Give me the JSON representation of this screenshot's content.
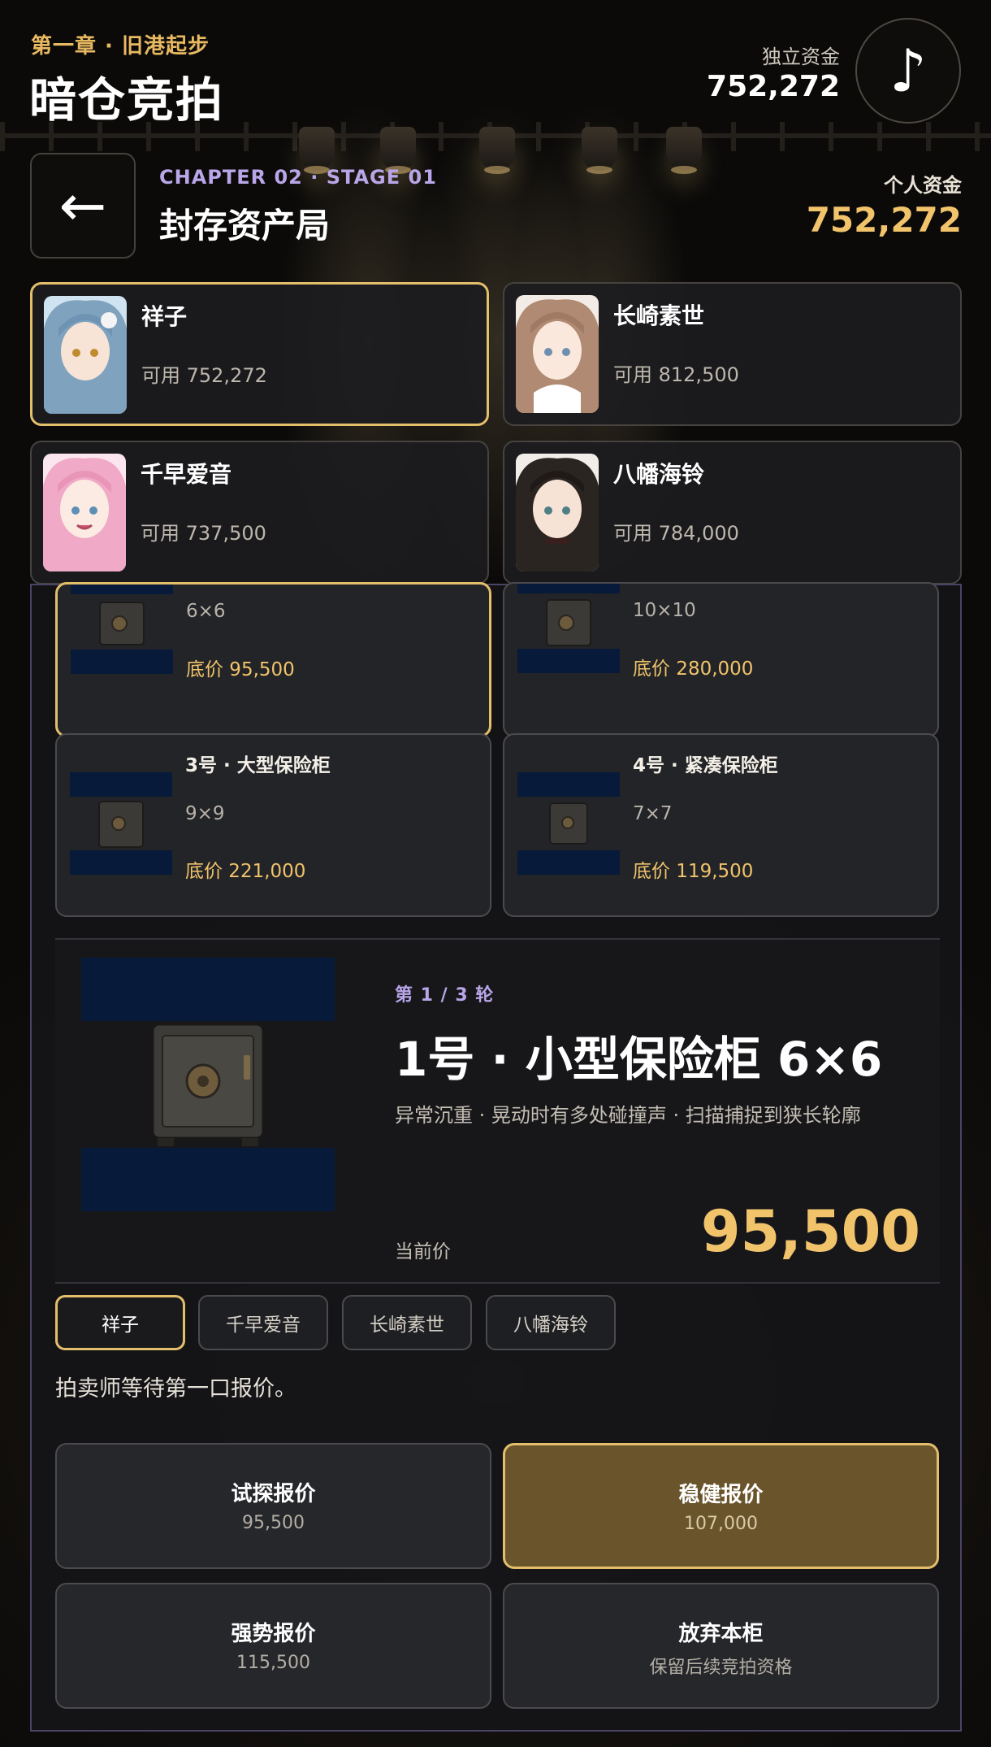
{
  "header": {
    "chapter": "第一章 · 旧港起步",
    "title": "暗仓竞拍",
    "funds_label": "独立资金",
    "funds_value": "752,272",
    "music_icon": "♪"
  },
  "stage": {
    "back_icon": "←",
    "code": "CHAPTER 02 · STAGE 01",
    "name": "封存资产局",
    "personal_funds_label": "个人资金",
    "personal_funds_value": "752,272"
  },
  "players": [
    {
      "name": "祥子",
      "available": "可用 752,272",
      "selected": true
    },
    {
      "name": "长崎素世",
      "available": "可用 812,500",
      "selected": false
    },
    {
      "name": "千早爱音",
      "available": "可用 737,500",
      "selected": false
    },
    {
      "name": "八幡海铃",
      "available": "可用 784,000",
      "selected": false
    }
  ],
  "lots": [
    {
      "name": "",
      "size": "6×6",
      "price": "底价 95,500",
      "selected": true
    },
    {
      "name": "",
      "size": "10×10",
      "price": "底价 280,000",
      "selected": false
    },
    {
      "name": "3号 · 大型保险柜",
      "size": "9×9",
      "price": "底价 221,000",
      "selected": false
    },
    {
      "name": "4号 · 紧凑保险柜",
      "size": "7×7",
      "price": "底价 119,500",
      "selected": false
    }
  ],
  "featured": {
    "round": "第 1 / 3 轮",
    "title": "1号 · 小型保险柜 6×6",
    "description": "异常沉重 · 晃动时有多处碰撞声 · 扫描捕捉到狭长轮廓",
    "current_price_label": "当前价",
    "current_price": "95,500"
  },
  "bidder_tabs": [
    {
      "label": "祥子",
      "active": true
    },
    {
      "label": "千早爱音",
      "active": false
    },
    {
      "label": "长崎素世",
      "active": false
    },
    {
      "label": "八幡海铃",
      "active": false
    }
  ],
  "auction_message": "拍卖师等待第一口报价。",
  "actions": [
    {
      "title": "试探报价",
      "sub": "95,500"
    },
    {
      "title": "稳健报价",
      "sub": "107,000"
    },
    {
      "title": "强势报价",
      "sub": "115,500"
    },
    {
      "title": "放弃本柜",
      "sub": "保留后续竞拍资格"
    }
  ],
  "colors": {
    "accent_gold": "#f1c36b",
    "accent_purple": "#b8a6e8",
    "selected_border": "#e3be6b"
  }
}
